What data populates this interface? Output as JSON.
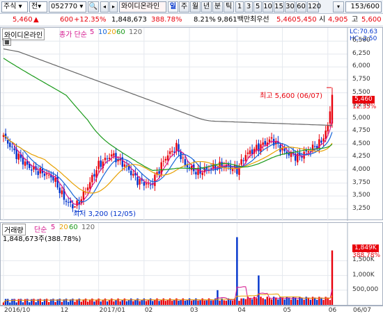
{
  "toolbar": {
    "market": "주식",
    "view_mode": "전",
    "code": "052770",
    "name": "와이디온라인",
    "periods": [
      "일",
      "주",
      "월",
      "년",
      "분",
      "틱"
    ],
    "active_period": "일",
    "minutes": [
      "1",
      "3",
      "5",
      "10",
      "15",
      "30",
      "60",
      "120"
    ],
    "count": "153/600"
  },
  "quote": {
    "price": "5,460",
    "arrow": "▲",
    "change": "600",
    "change_pct": "+12.35%",
    "volume": "1,848,673",
    "vol_ratio": "388.78%",
    "turnover": "8.21%",
    "amount": "9,861백만",
    "bid_label": "최우선",
    "bid": "5,460",
    "ask": "5,450",
    "open_label": "시",
    "open": "4,905",
    "high_label": "고",
    "high": "5,600"
  },
  "price_chart": {
    "legend_name": "와이디온라인",
    "ma_label": "종가 단순",
    "ma_periods": [
      "5",
      "10",
      "20",
      "60",
      "120"
    ],
    "lc": "LC:70.63",
    "hc": "HC:-2.50",
    "y_ticks": [
      "6,500",
      "6,250",
      "6,000",
      "5,750",
      "5,500",
      "5,250",
      "5,000",
      "4,750",
      "4,500",
      "4,250",
      "4,000",
      "3,750",
      "3,500",
      "3,250"
    ],
    "current_tag": "5,460",
    "pct_tag": "12.35%",
    "high_annot": "최고 5,600 (06/07)",
    "low_annot": "최저 3,200 (12/05)",
    "colors": {
      "up": "#e8000b",
      "down": "#0033cc",
      "ma5": "#d4148c",
      "ma10": "#1565d8",
      "ma20": "#e8a000",
      "ma60": "#1a9a1a",
      "ma120": "#666666"
    }
  },
  "volume_chart": {
    "legend_name": "거래량",
    "ma_label": "단순",
    "ma_periods": [
      "5",
      "20",
      "60",
      "120"
    ],
    "value_text": "1,848,673주(388.78%)",
    "y_ticks": [
      "1,500K",
      "1,000K",
      "500,000"
    ],
    "current_tag": "1,849K",
    "pct_tag": "388.78%"
  },
  "x_axis": {
    "labels": [
      "2016/10",
      "12",
      "2017/01",
      "02",
      "03",
      "04",
      "05",
      "06"
    ],
    "right_label": "06/07"
  },
  "chart_data": {
    "type": "candlestick",
    "n": 153,
    "ylim": [
      3125,
      6625
    ],
    "keypoints": [
      [
        0,
        4650
      ],
      [
        6,
        4300
      ],
      [
        12,
        4050
      ],
      [
        18,
        3950
      ],
      [
        23,
        3850
      ],
      [
        28,
        3450
      ],
      [
        33,
        3250
      ],
      [
        38,
        3600
      ],
      [
        44,
        4100
      ],
      [
        50,
        4300
      ],
      [
        56,
        4100
      ],
      [
        62,
        3800
      ],
      [
        68,
        3700
      ],
      [
        75,
        4250
      ],
      [
        80,
        4450
      ],
      [
        84,
        4100
      ],
      [
        90,
        3950
      ],
      [
        96,
        4050
      ],
      [
        102,
        4100
      ],
      [
        108,
        4000
      ],
      [
        112,
        4300
      ],
      [
        118,
        4450
      ],
      [
        124,
        4600
      ],
      [
        130,
        4350
      ],
      [
        136,
        4250
      ],
      [
        142,
        4400
      ],
      [
        147,
        4550
      ],
      [
        150,
        4850
      ],
      [
        152,
        5460
      ]
    ],
    "volume_spikes": [
      [
        99,
        500
      ],
      [
        108,
        2300
      ],
      [
        118,
        1000
      ],
      [
        152,
        1849
      ]
    ]
  }
}
